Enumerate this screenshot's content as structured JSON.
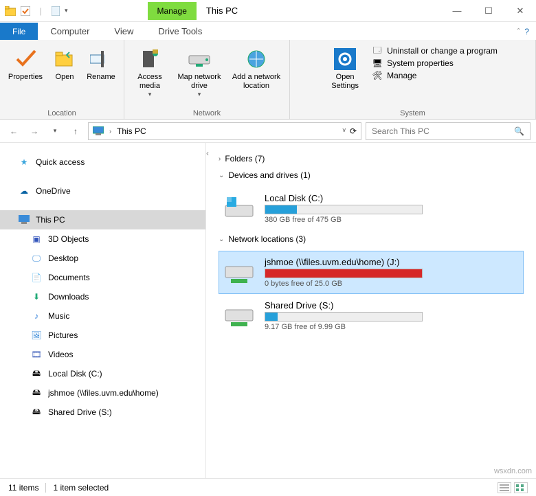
{
  "titlebar": {
    "manage": "Manage",
    "title": "This PC"
  },
  "tabs": {
    "file": "File",
    "computer": "Computer",
    "view": "View",
    "drivetools": "Drive Tools"
  },
  "ribbon": {
    "location": {
      "properties": "Properties",
      "open": "Open",
      "rename": "Rename",
      "label": "Location"
    },
    "network": {
      "access": "Access\nmedia",
      "map": "Map network\ndrive",
      "add": "Add a network\nlocation",
      "label": "Network"
    },
    "settings": {
      "open": "Open\nSettings",
      "uninstall": "Uninstall or change a program",
      "sysprops": "System properties",
      "manage": "Manage",
      "label": "System"
    }
  },
  "address": {
    "breadcrumb": "This PC",
    "search_placeholder": "Search This PC"
  },
  "nav": {
    "quick": "Quick access",
    "onedrive": "OneDrive",
    "thispc": "This PC",
    "items": [
      "3D Objects",
      "Desktop",
      "Documents",
      "Downloads",
      "Music",
      "Pictures",
      "Videos",
      "Local Disk (C:)",
      "jshmoe (\\\\files.uvm.edu\\home)",
      "Shared Drive (S:)"
    ]
  },
  "sections": {
    "folders": "Folders (7)",
    "devices": "Devices and drives (1)",
    "network": "Network locations (3)"
  },
  "drives": {
    "local": {
      "name": "Local Disk (C:)",
      "sub": "380 GB free of 475 GB",
      "pct": 20
    },
    "jshmoe": {
      "name": "jshmoe (\\\\files.uvm.edu\\home) (J:)",
      "sub": "0 bytes free of 25.0 GB",
      "pct": 100
    },
    "shared": {
      "name": "Shared Drive (S:)",
      "sub": "9.17 GB free of 9.99 GB",
      "pct": 8
    }
  },
  "status": {
    "items": "11 items",
    "selected": "1 item selected"
  },
  "watermark": "wsxdn.com"
}
